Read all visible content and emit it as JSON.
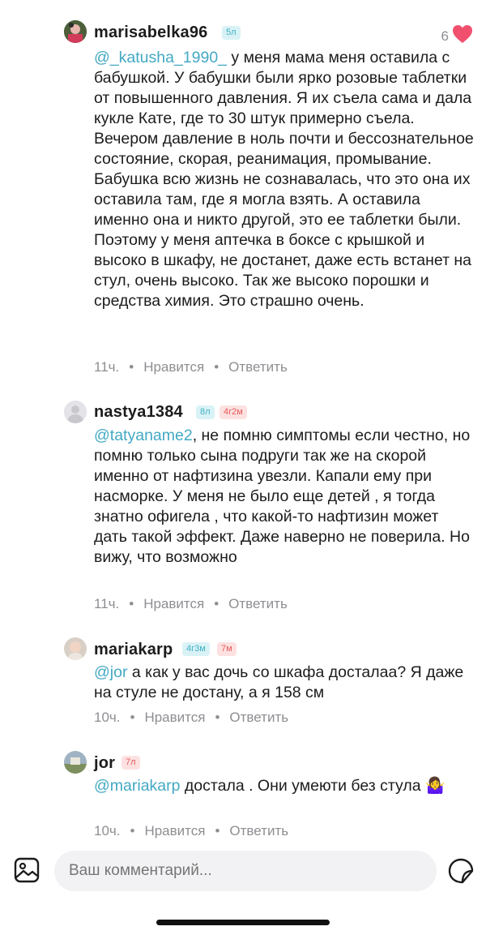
{
  "comments": [
    {
      "username": "marisabelka96",
      "badges": [
        "5л"
      ],
      "likes": "6",
      "mention": "@_katusha_1990_",
      "text": " у меня мама меня оставила с бабушкой. У бабушки были ярко розовые таблетки от повышенного давления. Я их съела сама и дала кукле Кате, где то 30 штук примерно съела. Вечером давление в ноль почти и бессознательное состояние, скорая, реанимация, промывание. Бабушка всю жизнь не сознавалась, что это она их оставила там, где я могла взять. А оставила именно она и никто другой, это ее таблетки были. Поэтому у меня аптечка в боксе с крышкой и высоко в шкафу, не достанет, даже есть встанет на стул, очень высоко. Так же высоко порошки и средства химия. Это страшно очень.",
      "time": "11ч.",
      "like_label": "Нравится",
      "reply_label": "Ответить"
    },
    {
      "username": "nastya1384",
      "badges": [
        "8л",
        "4г2м"
      ],
      "mention": "@tatyaname2",
      "text": ", не помню симптомы если честно, но помню только сына подруги так же на скорой именно от нафтизина увезли. Капали ему при насморке. У меня не было еще детей , я тогда знатно офигела , что какой-то нафтизин может дать такой эффект. Даже наверно не поверила. Но вижу, что возможно",
      "time": "11ч.",
      "like_label": "Нравится",
      "reply_label": "Ответить"
    },
    {
      "username": "mariakarp",
      "badges": [
        "4г3м",
        "7м"
      ],
      "mention": "@jor",
      "text": " а как у вас дочь со шкафа досталаа? Я даже на стуле не достану, а я 158 см",
      "time": "10ч.",
      "like_label": "Нравится",
      "reply_label": "Ответить"
    },
    {
      "username": "jor",
      "badges": [
        "7л"
      ],
      "mention": "@mariakarp",
      "text": " достала  . Они умеюти без стула 🤷‍♀️",
      "time": "10ч.",
      "like_label": "Нравится",
      "reply_label": "Ответить"
    }
  ],
  "input": {
    "placeholder": "Ваш комментарий..."
  },
  "icons": {
    "image": "image-icon",
    "sticker": "sticker-icon",
    "like": "heart-icon"
  },
  "colors": {
    "mention": "#43a9c4",
    "heart": "#f0506e",
    "badge_teal": "#3fb0c4",
    "badge_pink": "#e55a5a"
  }
}
